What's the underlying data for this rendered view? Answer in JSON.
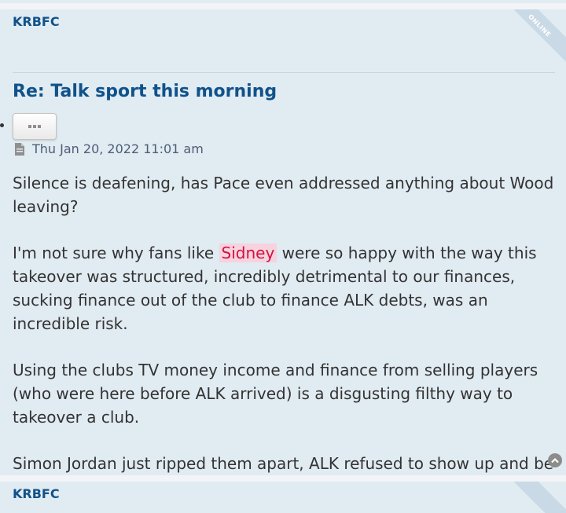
{
  "post": {
    "author": "KRBFC",
    "online_label": "ONLINE",
    "title": "Re: Talk sport this morning",
    "timestamp": "Thu Jan 20, 2022 11:01 am",
    "paragraphs": [
      {
        "text": "Silence is deafening, has Pace even addressed anything about Wood leaving?"
      },
      {
        "before": "I'm not sure why fans like ",
        "mention": "Sidney",
        "after": " were so happy with the way this takeover was structured, incredibly detrimental to our finances, sucking finance out of the club to finance ALK debts, was an incredible risk."
      },
      {
        "text": "Using the clubs TV money income and finance from selling players (who were here before ALK arrived) is a disgusting filthy way to takeover a club."
      },
      {
        "text": "Simon Jordan just ripped them apart, ALK refused to show up and be interviewed."
      }
    ]
  },
  "next_post": {
    "author": "KRBFC"
  },
  "icons": {
    "file": "file-icon",
    "dots": "ellipsis-icon",
    "back_to_top": "chevron-up-icon"
  },
  "colors": {
    "post_bg": "#e1ebf2",
    "author": "#105289",
    "mention_bg": "#f6d3de",
    "mention_text": "#d31141"
  }
}
